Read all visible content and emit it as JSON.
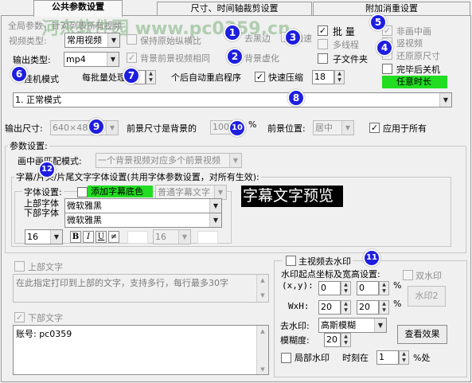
{
  "tabs": [
    "公共参数设置",
    "尺寸、时间轴裁剪设置",
    "附加消重设置"
  ],
  "watermark": "河东软件园 www.pc0359.cn",
  "row1": {
    "full_params_label": "全局参数，针对列表所有视频",
    "video_type_label": "视频类型:",
    "video_type_value": "常用视频",
    "keep_aspect_label": "保持原始纵横比",
    "remove_black_label": "去黑边",
    "speed_label": "加速",
    "batch_label": "批 量",
    "multithread_label": "多线程",
    "subfolder_label": "子文件夹",
    "non_pip_label": "非画中画",
    "vertical_label": "竖视频",
    "restore_size_label": "还原原尺寸",
    "shutdown_label": "完毕后关机",
    "any_duration_label": "任意时长"
  },
  "row2": {
    "output_type_label": "输出类型:",
    "output_type_value": "mp4",
    "bg_fg_same_label": "背景前景视频相同",
    "bg_blur_label": "背景虚化"
  },
  "row3": {
    "hang_mode_label": "挂机模式",
    "batch_restart_label": "每批量处理",
    "batch_restart_value": "2",
    "restart_suffix_label": "个后自动重启程序",
    "fast_compress_label": "快速压缩",
    "fast_compress_value": "18"
  },
  "mode_value": "1. 正常模式",
  "output_size": {
    "label": "输出尺寸:",
    "value": "640×480",
    "fg_ratio_label": "前景尺寸是背景的",
    "fg_ratio_value": "100",
    "percent": "%",
    "bg_pos_label": "前景位置:",
    "bg_pos_value": "居中",
    "apply_all_label": "应用于所有"
  },
  "params": {
    "group_label": "参数设置:",
    "pip_mode_label": "画中画匹配模式:",
    "pip_mode_value": "一个背景视频对应多个前景视频",
    "subtitle_group_label": "字幕/片头/片尾文字字体设置(共用字体参数设置，对所有生效):",
    "font_settings_label": "字体设置:",
    "add_bg_label": "添加字幕底色",
    "normal_subtitle": "普通字幕文字",
    "top_font_label": "上部字体",
    "bottom_font_label": "下部字体",
    "top_font_value": "微软雅黑",
    "bottom_font_value": "微软雅黑",
    "font_size_1": "16",
    "font_size_2": "16",
    "format_buttons": [
      "B",
      "I",
      "U",
      "≠"
    ],
    "preview_text": "字幕文字预览"
  },
  "text_sections": {
    "top_text_label": "上部文字",
    "top_text_value": "在此指定打印到上部的文字，支持多行，每行最多30字",
    "bottom_text_label": "下部文字",
    "bottom_text_value": "账号: pc0359"
  },
  "watermark_panel": {
    "main_remove_label": "主视频去水印",
    "start_pos_label": "水印起点坐标及宽高设置:",
    "double_wm_label": "双水印",
    "xy_label": "(x,y):",
    "x_value": "0",
    "y_value": "0",
    "wh_label": "WxH:",
    "w_value": "20",
    "h_value": "20",
    "percent": "%",
    "wm2_label": "水印2",
    "remove_method_label": "去水印:",
    "remove_method_value": "高斯模糊",
    "blur_label": "模糊度:",
    "blur_value": "20",
    "view_effect_label": "查看效果",
    "local_wm_label": "局部水印",
    "time_label": "时刻在",
    "time_value": "1",
    "time_suffix": "%处"
  },
  "badges": [
    "1",
    "2",
    "3",
    "4",
    "5",
    "6",
    "7",
    "8",
    "9",
    "10",
    "11",
    "12"
  ],
  "colors": {
    "badge": "#1e1ee0",
    "green": "#22dd22",
    "preview_bg": "#000000",
    "preview_fg": "#ffffff"
  }
}
